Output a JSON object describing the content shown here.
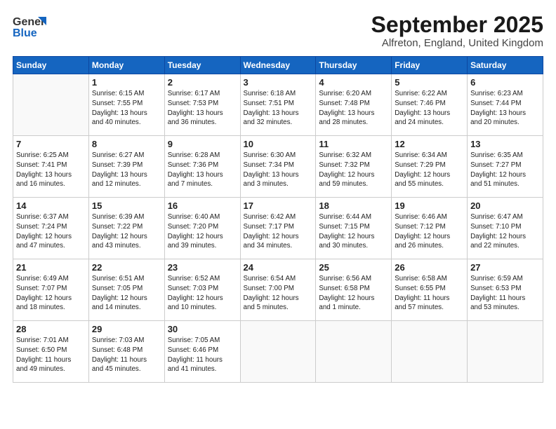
{
  "header": {
    "logo_general": "General",
    "logo_blue": "Blue",
    "month": "September 2025",
    "location": "Alfreton, England, United Kingdom"
  },
  "weekdays": [
    "Sunday",
    "Monday",
    "Tuesday",
    "Wednesday",
    "Thursday",
    "Friday",
    "Saturday"
  ],
  "weeks": [
    [
      {
        "day": "",
        "info": ""
      },
      {
        "day": "1",
        "info": "Sunrise: 6:15 AM\nSunset: 7:55 PM\nDaylight: 13 hours\nand 40 minutes."
      },
      {
        "day": "2",
        "info": "Sunrise: 6:17 AM\nSunset: 7:53 PM\nDaylight: 13 hours\nand 36 minutes."
      },
      {
        "day": "3",
        "info": "Sunrise: 6:18 AM\nSunset: 7:51 PM\nDaylight: 13 hours\nand 32 minutes."
      },
      {
        "day": "4",
        "info": "Sunrise: 6:20 AM\nSunset: 7:48 PM\nDaylight: 13 hours\nand 28 minutes."
      },
      {
        "day": "5",
        "info": "Sunrise: 6:22 AM\nSunset: 7:46 PM\nDaylight: 13 hours\nand 24 minutes."
      },
      {
        "day": "6",
        "info": "Sunrise: 6:23 AM\nSunset: 7:44 PM\nDaylight: 13 hours\nand 20 minutes."
      }
    ],
    [
      {
        "day": "7",
        "info": "Sunrise: 6:25 AM\nSunset: 7:41 PM\nDaylight: 13 hours\nand 16 minutes."
      },
      {
        "day": "8",
        "info": "Sunrise: 6:27 AM\nSunset: 7:39 PM\nDaylight: 13 hours\nand 12 minutes."
      },
      {
        "day": "9",
        "info": "Sunrise: 6:28 AM\nSunset: 7:36 PM\nDaylight: 13 hours\nand 7 minutes."
      },
      {
        "day": "10",
        "info": "Sunrise: 6:30 AM\nSunset: 7:34 PM\nDaylight: 13 hours\nand 3 minutes."
      },
      {
        "day": "11",
        "info": "Sunrise: 6:32 AM\nSunset: 7:32 PM\nDaylight: 12 hours\nand 59 minutes."
      },
      {
        "day": "12",
        "info": "Sunrise: 6:34 AM\nSunset: 7:29 PM\nDaylight: 12 hours\nand 55 minutes."
      },
      {
        "day": "13",
        "info": "Sunrise: 6:35 AM\nSunset: 7:27 PM\nDaylight: 12 hours\nand 51 minutes."
      }
    ],
    [
      {
        "day": "14",
        "info": "Sunrise: 6:37 AM\nSunset: 7:24 PM\nDaylight: 12 hours\nand 47 minutes."
      },
      {
        "day": "15",
        "info": "Sunrise: 6:39 AM\nSunset: 7:22 PM\nDaylight: 12 hours\nand 43 minutes."
      },
      {
        "day": "16",
        "info": "Sunrise: 6:40 AM\nSunset: 7:20 PM\nDaylight: 12 hours\nand 39 minutes."
      },
      {
        "day": "17",
        "info": "Sunrise: 6:42 AM\nSunset: 7:17 PM\nDaylight: 12 hours\nand 34 minutes."
      },
      {
        "day": "18",
        "info": "Sunrise: 6:44 AM\nSunset: 7:15 PM\nDaylight: 12 hours\nand 30 minutes."
      },
      {
        "day": "19",
        "info": "Sunrise: 6:46 AM\nSunset: 7:12 PM\nDaylight: 12 hours\nand 26 minutes."
      },
      {
        "day": "20",
        "info": "Sunrise: 6:47 AM\nSunset: 7:10 PM\nDaylight: 12 hours\nand 22 minutes."
      }
    ],
    [
      {
        "day": "21",
        "info": "Sunrise: 6:49 AM\nSunset: 7:07 PM\nDaylight: 12 hours\nand 18 minutes."
      },
      {
        "day": "22",
        "info": "Sunrise: 6:51 AM\nSunset: 7:05 PM\nDaylight: 12 hours\nand 14 minutes."
      },
      {
        "day": "23",
        "info": "Sunrise: 6:52 AM\nSunset: 7:03 PM\nDaylight: 12 hours\nand 10 minutes."
      },
      {
        "day": "24",
        "info": "Sunrise: 6:54 AM\nSunset: 7:00 PM\nDaylight: 12 hours\nand 5 minutes."
      },
      {
        "day": "25",
        "info": "Sunrise: 6:56 AM\nSunset: 6:58 PM\nDaylight: 12 hours\nand 1 minute."
      },
      {
        "day": "26",
        "info": "Sunrise: 6:58 AM\nSunset: 6:55 PM\nDaylight: 11 hours\nand 57 minutes."
      },
      {
        "day": "27",
        "info": "Sunrise: 6:59 AM\nSunset: 6:53 PM\nDaylight: 11 hours\nand 53 minutes."
      }
    ],
    [
      {
        "day": "28",
        "info": "Sunrise: 7:01 AM\nSunset: 6:50 PM\nDaylight: 11 hours\nand 49 minutes."
      },
      {
        "day": "29",
        "info": "Sunrise: 7:03 AM\nSunset: 6:48 PM\nDaylight: 11 hours\nand 45 minutes."
      },
      {
        "day": "30",
        "info": "Sunrise: 7:05 AM\nSunset: 6:46 PM\nDaylight: 11 hours\nand 41 minutes."
      },
      {
        "day": "",
        "info": ""
      },
      {
        "day": "",
        "info": ""
      },
      {
        "day": "",
        "info": ""
      },
      {
        "day": "",
        "info": ""
      }
    ]
  ]
}
